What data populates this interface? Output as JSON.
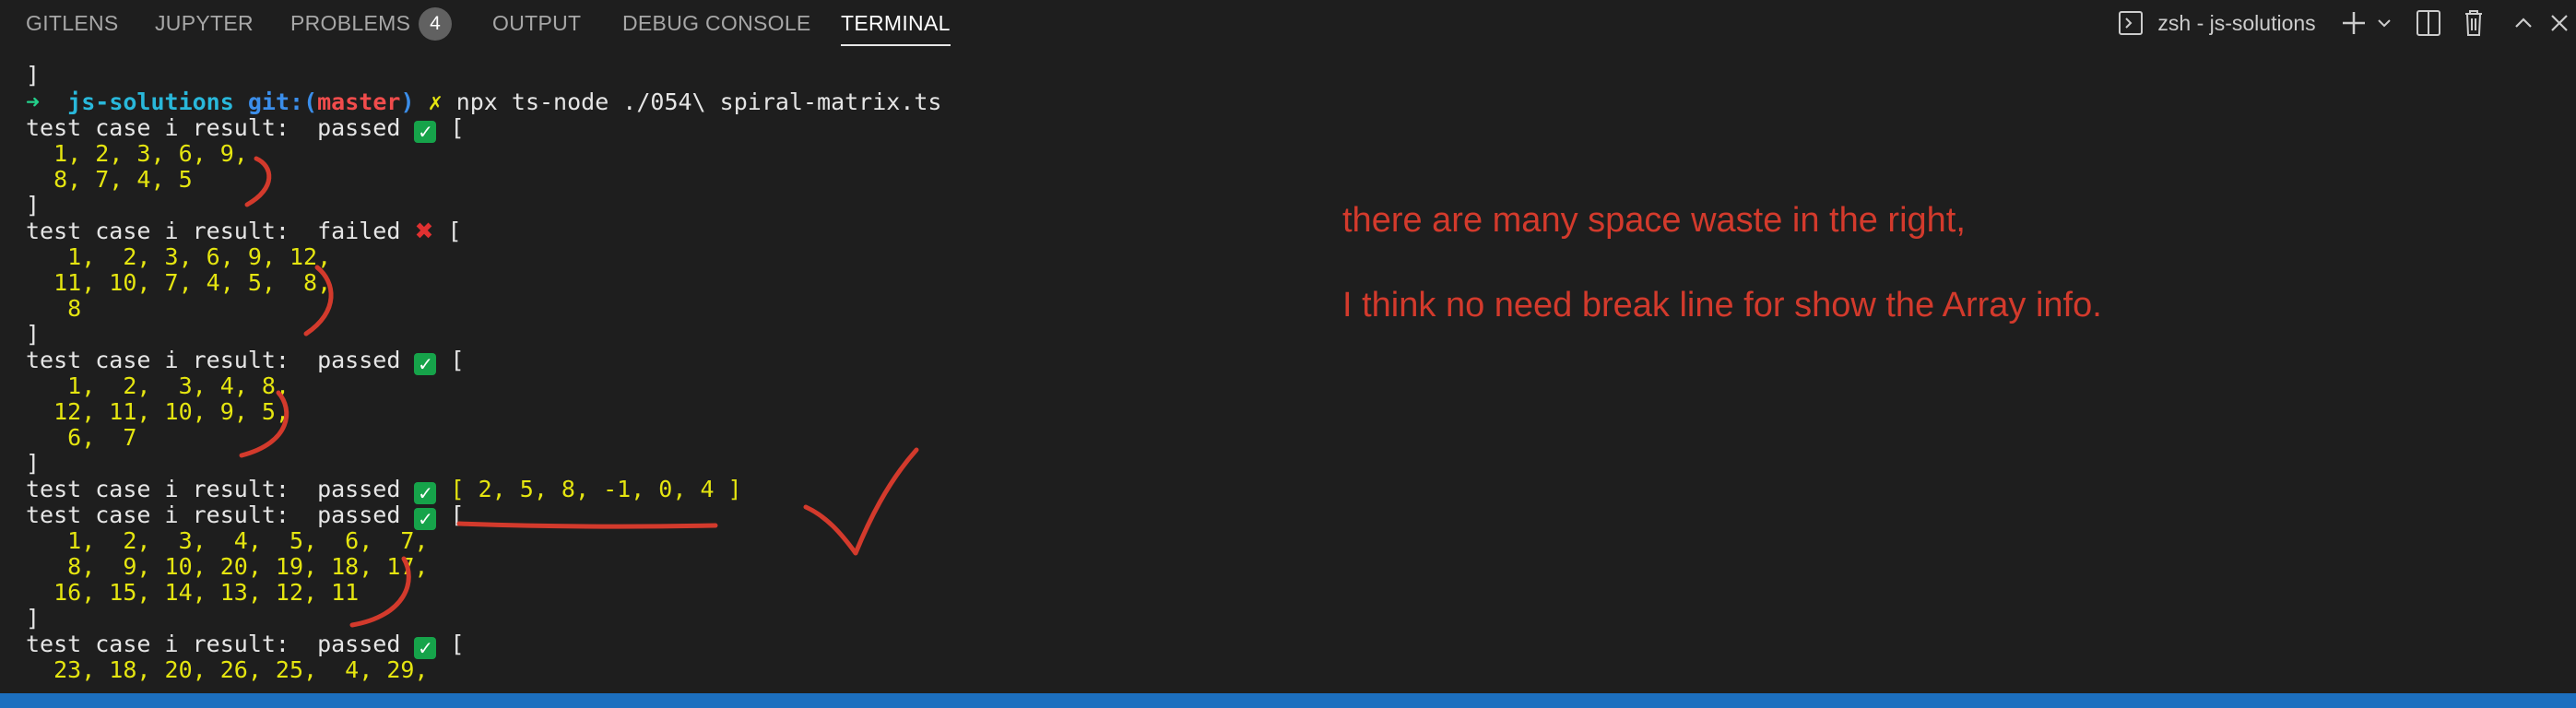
{
  "tabs": [
    {
      "label": "GITLENS"
    },
    {
      "label": "JUPYTER"
    },
    {
      "label": "PROBLEMS",
      "badge": "4"
    },
    {
      "label": "OUTPUT"
    },
    {
      "label": "DEBUG CONSOLE"
    },
    {
      "label": "TERMINAL",
      "active": true
    }
  ],
  "terminal_controls": {
    "shell_label": "zsh - js-solutions",
    "icons": [
      "terminal-icon",
      "plus-icon",
      "chevron-down-icon",
      "split-icon",
      "trash-icon",
      "chevron-up-icon",
      "close-icon"
    ]
  },
  "terminal": {
    "close_bracket": "]",
    "prompt_arrow": "➜",
    "prompt_dir": "js-solutions",
    "prompt_git": "git:(",
    "prompt_branch": "master",
    "prompt_git_close": ")",
    "prompt_dirty": "✗",
    "command": "npx ts-node ./054\\ spiral-matrix.ts",
    "result_prefix": "test case i result:  ",
    "passed": "passed",
    "failed": "failed",
    "open_bracket": "[",
    "lines": {
      "c1r1": "  1, 2, 3, 6, 9,",
      "c1r2": "  8, 7, 4, 5",
      "c2r1": "   1,  2, 3, 6, 9, 12,",
      "c2r2": "  11, 10, 7, 4, 5,  8,",
      "c2r3": "   8",
      "c3r1": "   1,  2,  3, 4, 8,",
      "c3r2": "  12, 11, 10, 9, 5,",
      "c3r3": "   6,  7",
      "c4inline": "[ 2, 5, 8, -1, 0, 4 ]",
      "c5r1": "   1,  2,  3,  4,  5,  6,  7,",
      "c5r2": "   8,  9, 10, 20, 19, 18, 17,",
      "c5r3": "  16, 15, 14, 13, 12, 11",
      "c6r1": "  23, 18, 20, 26, 25,  4, 29,"
    }
  },
  "annotations": {
    "note1": "there are many space waste in the right,",
    "note2": "I think no need break line for show the Array info.",
    "ink_color": "#d33a2c"
  },
  "colors": {
    "background": "#1e1e1e",
    "status_bar": "#1c6fbf",
    "number_yellow": "#e5e510"
  }
}
